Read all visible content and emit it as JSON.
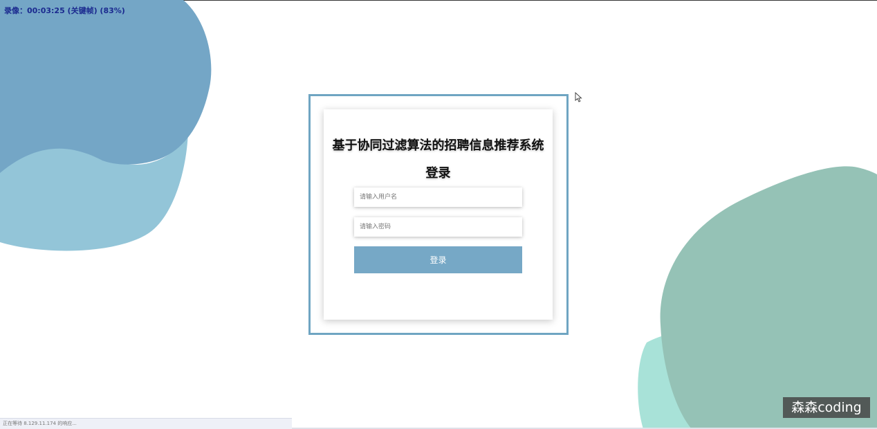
{
  "recording": {
    "text": "录像：00:03:25 (关键帧) (83%)"
  },
  "login": {
    "system_title": "基于协同过滤算法的招聘信息推荐系统",
    "heading": "登录",
    "username_placeholder": "请输入用户名",
    "password_placeholder": "请输入密码",
    "submit_label": "登录"
  },
  "browser": {
    "status_text": "正在等待 8.129.11.174 的响应..."
  },
  "watermark": {
    "text": "森森coding"
  },
  "colors": {
    "accent": "#76a8c6",
    "frame": "#6fa5c2",
    "blob_blue_dark": "#74a6c6",
    "blob_blue_light": "#93c5d8",
    "blob_green": "#95c2b6",
    "blob_mint": "#a8e2d8"
  },
  "icons": {
    "cursor": "mouse-pointer-icon"
  }
}
